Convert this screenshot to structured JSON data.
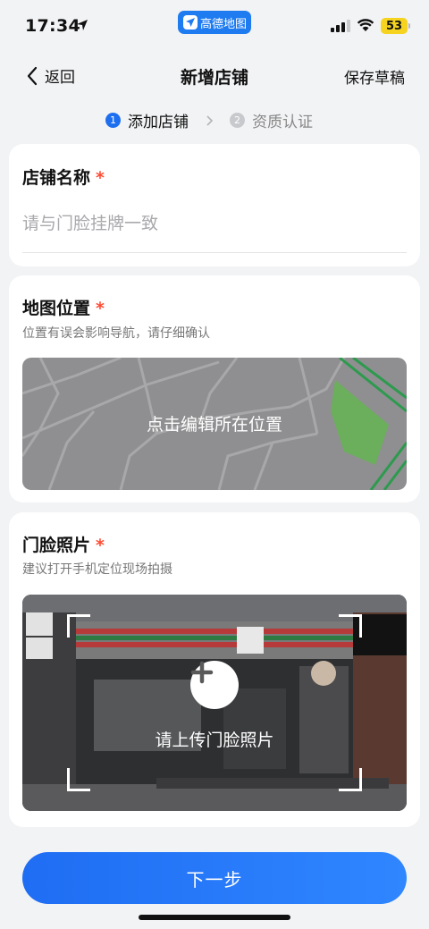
{
  "status_bar": {
    "time": "17:34",
    "app_badge": "高德地图",
    "battery": "53",
    "icons": [
      "location-arrow-icon",
      "signal-icon",
      "wifi-icon",
      "battery-icon"
    ]
  },
  "nav": {
    "back_label": "返回",
    "title": "新增店铺",
    "save_draft": "保存草稿"
  },
  "steps": [
    {
      "num": "1",
      "label": "添加店铺",
      "active": true
    },
    {
      "num": "2",
      "label": "资质认证",
      "active": false
    }
  ],
  "store_name": {
    "title": "店铺名称",
    "required_mark": "*",
    "value": "",
    "placeholder": "请与门脸挂牌一致"
  },
  "map_location": {
    "title": "地图位置",
    "required_mark": "*",
    "subtitle": "位置有误会影响导航，请仔细确认",
    "overlay_text": "点击编辑所在位置"
  },
  "storefront_photo": {
    "title": "门脸照片",
    "required_mark": "*",
    "subtitle": "建议打开手机定位现场拍摄",
    "overlay_text": "请上传门脸照片"
  },
  "next_button": "下一步",
  "colors": {
    "accent": "#1e6ef0",
    "required": "#ff4b33",
    "background": "#f2f3f5",
    "battery": "#f5d31f"
  }
}
